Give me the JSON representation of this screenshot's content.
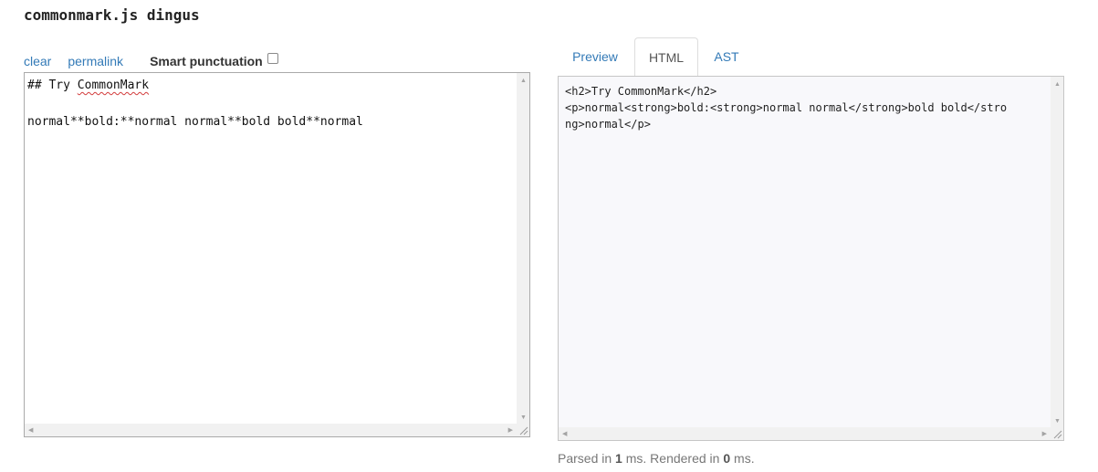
{
  "header": {
    "title": "commonmark.js dingus"
  },
  "toolbar": {
    "clear_label": "clear",
    "permalink_label": "permalink",
    "smart_punctuation_label": "Smart punctuation",
    "smart_punctuation_checked": false
  },
  "editor": {
    "heading_prefix": "## Try ",
    "heading_word": "CommonMark",
    "line_blank": "",
    "line_body": "normal**bold:**normal normal**bold bold**normal"
  },
  "tabs": [
    {
      "label": "Preview",
      "active": false
    },
    {
      "label": "HTML",
      "active": true
    },
    {
      "label": "AST",
      "active": false
    }
  ],
  "output": {
    "lines": [
      "<h2>Try CommonMark</h2>",
      "<p>normal<strong>bold:<strong>normal normal</strong>bold bold</stro",
      "ng>normal</p>"
    ]
  },
  "timing": {
    "parsed_prefix": "Parsed in ",
    "parsed_value": "1",
    "parsed_suffix": " ms. Rendered in ",
    "rendered_value": "0",
    "rendered_suffix": " ms."
  },
  "icons": {
    "scroll_up": "arrow-up-icon",
    "scroll_down": "arrow-down-icon",
    "scroll_left": "arrow-left-icon",
    "scroll_right": "arrow-right-icon",
    "resize": "resize-grip-icon"
  }
}
